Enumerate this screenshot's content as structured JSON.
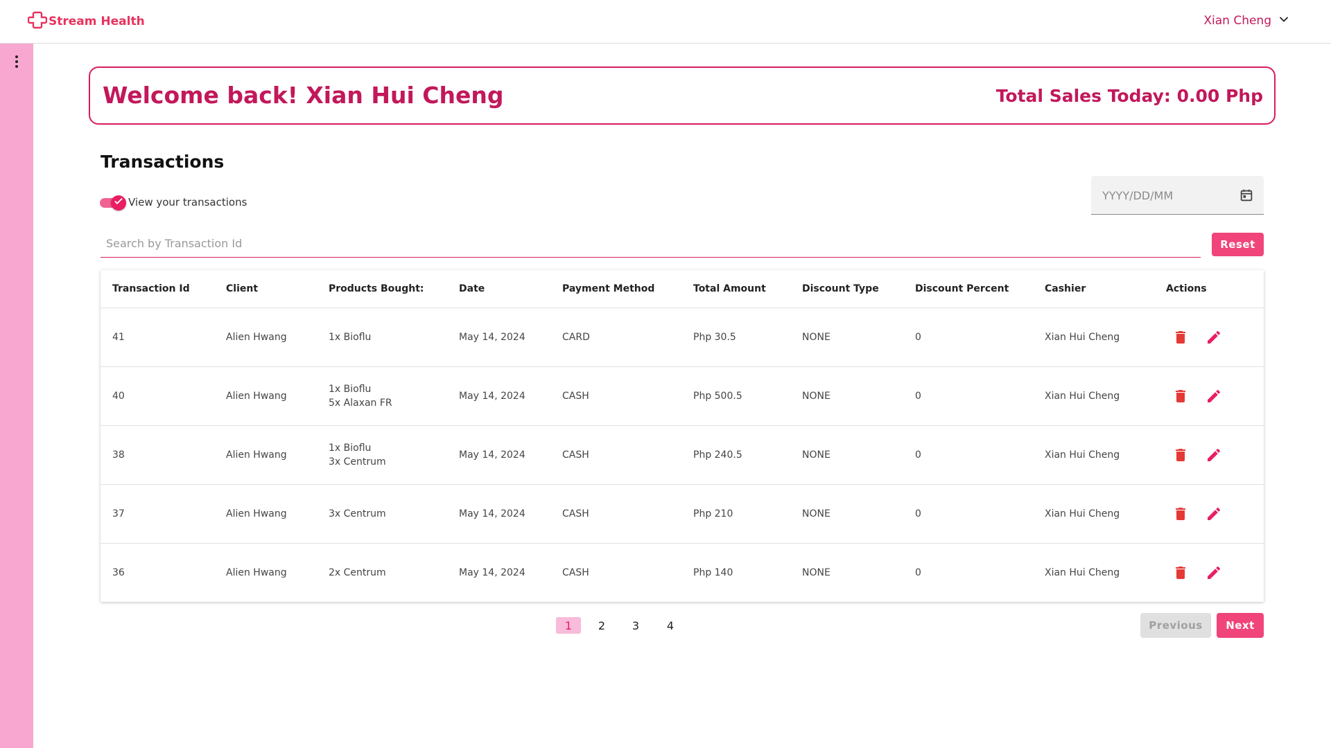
{
  "header": {
    "brand": "Stream Health",
    "logo_icon": "medical-cross-icon",
    "user_name": "Xian Cheng",
    "user_menu_icon": "chevron-down-icon"
  },
  "sidebar": {
    "menu_icon": "more-vertical-icon"
  },
  "welcome": {
    "greeting": "Welcome back! Xian Hui Cheng",
    "total_sales": "Total Sales Today: 0.00 Php"
  },
  "transactions": {
    "title": "Transactions",
    "toggle_label": "View your transactions",
    "toggle_on": true,
    "date_placeholder": "YYYY/DD/MM",
    "date_icon": "calendar-icon",
    "search_placeholder": "Search by Transaction Id",
    "reset_label": "Reset"
  },
  "table": {
    "columns": [
      "Transaction Id",
      "Client",
      "Products Bought:",
      "Date",
      "Payment Method",
      "Total Amount",
      "Discount Type",
      "Discount Percent",
      "Cashier",
      "Actions"
    ],
    "rows": [
      {
        "id": "41",
        "client": "Alien Hwang",
        "products": [
          "1x Bioflu"
        ],
        "date": "May 14, 2024",
        "payment": "CARD",
        "total": "Php 30.5",
        "discount_type": "NONE",
        "discount_percent": "0",
        "cashier": "Xian Hui Cheng"
      },
      {
        "id": "40",
        "client": "Alien Hwang",
        "products": [
          "1x Bioflu",
          "5x Alaxan FR"
        ],
        "date": "May 14, 2024",
        "payment": "CASH",
        "total": "Php 500.5",
        "discount_type": "NONE",
        "discount_percent": "0",
        "cashier": "Xian Hui Cheng"
      },
      {
        "id": "38",
        "client": "Alien Hwang",
        "products": [
          "1x Bioflu",
          "3x Centrum"
        ],
        "date": "May 14, 2024",
        "payment": "CASH",
        "total": "Php 240.5",
        "discount_type": "NONE",
        "discount_percent": "0",
        "cashier": "Xian Hui Cheng"
      },
      {
        "id": "37",
        "client": "Alien Hwang",
        "products": [
          "3x Centrum"
        ],
        "date": "May 14, 2024",
        "payment": "CASH",
        "total": "Php 210",
        "discount_type": "NONE",
        "discount_percent": "0",
        "cashier": "Xian Hui Cheng"
      },
      {
        "id": "36",
        "client": "Alien Hwang",
        "products": [
          "2x Centrum"
        ],
        "date": "May 14, 2024",
        "payment": "CASH",
        "total": "Php 140",
        "discount_type": "NONE",
        "discount_percent": "0",
        "cashier": "Xian Hui Cheng"
      }
    ],
    "delete_icon": "trash-icon",
    "edit_icon": "pencil-icon"
  },
  "pagination": {
    "pages": [
      "1",
      "2",
      "3",
      "4"
    ],
    "current": "1",
    "previous_label": "Previous",
    "next_label": "Next"
  },
  "colors": {
    "brand": "#e8335f",
    "accent": "#d81b60",
    "sidebar": "#f8a8d0",
    "delete": "#e53935",
    "edit": "#e91e63"
  }
}
